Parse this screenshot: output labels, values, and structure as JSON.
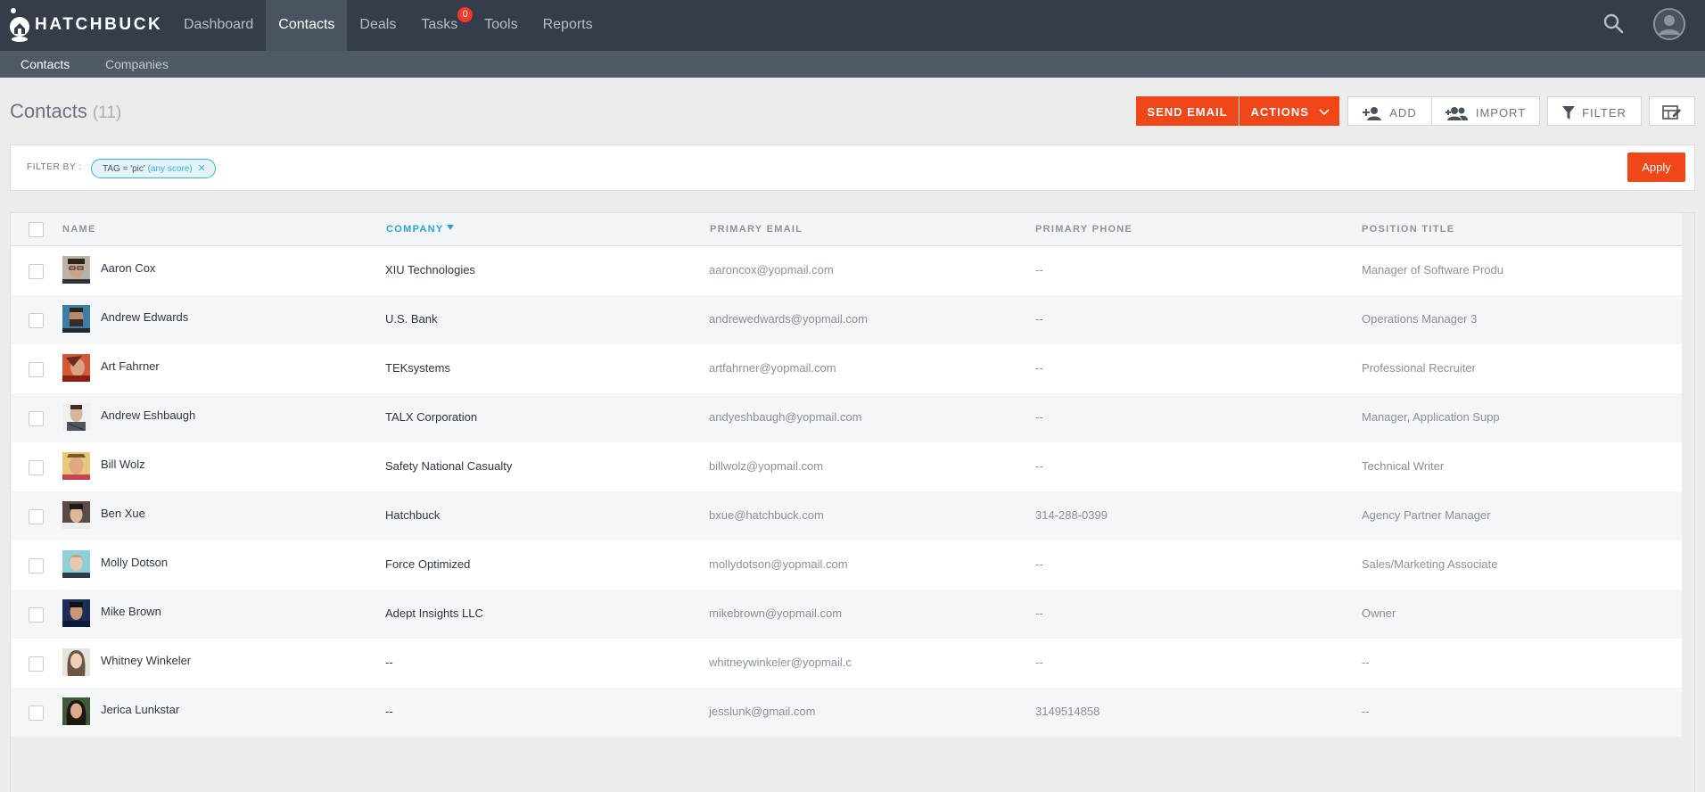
{
  "app": {
    "brand": "HATCHBUCK"
  },
  "nav": {
    "items": [
      {
        "label": "Dashboard",
        "active": false
      },
      {
        "label": "Contacts",
        "active": true
      },
      {
        "label": "Deals",
        "active": false
      },
      {
        "label": "Tasks",
        "active": false,
        "badge": "0"
      },
      {
        "label": "Tools",
        "active": false
      },
      {
        "label": "Reports",
        "active": false
      }
    ]
  },
  "subnav": {
    "items": [
      {
        "label": "Contacts",
        "active": true
      },
      {
        "label": "Companies",
        "active": false
      }
    ]
  },
  "page": {
    "title": "Contacts",
    "count": "(11)"
  },
  "toolbar": {
    "send_email": "SEND EMAIL",
    "actions": "ACTIONS",
    "add": "ADD",
    "import": "IMPORT",
    "filter": "FILTER"
  },
  "filter": {
    "label": "FILTER BY :",
    "tag_text": "TAG = 'pic'",
    "tag_score": "(any score)",
    "apply": "Apply"
  },
  "table": {
    "columns": {
      "name": "NAME",
      "company": "COMPANY",
      "email": "PRIMARY EMAIL",
      "phone": "PRIMARY PHONE",
      "title": "POSITION TITLE"
    },
    "rows": [
      {
        "name": "Aaron Cox",
        "company": "XIU Technologies",
        "email": "aaroncox@yopmail.com",
        "phone": "--",
        "title": "Manager of Software Produ"
      },
      {
        "name": "Andrew Edwards",
        "company": "U.S. Bank",
        "email": "andrewedwards@yopmail.com",
        "phone": "--",
        "title": "Operations Manager 3"
      },
      {
        "name": "Art Fahrner",
        "company": "TEKsystems",
        "email": "artfahrner@yopmail.com",
        "phone": "--",
        "title": "Professional Recruiter"
      },
      {
        "name": "Andrew Eshbaugh",
        "company": "TALX Corporation",
        "email": "andyeshbaugh@yopmail.com",
        "phone": "--",
        "title": "Manager, Application Supp"
      },
      {
        "name": "Bill Wolz",
        "company": "Safety National Casualty",
        "email": "billwolz@yopmail.com",
        "phone": "--",
        "title": "Technical Writer"
      },
      {
        "name": "Ben Xue",
        "company": "Hatchbuck",
        "email": "bxue@hatchbuck.com",
        "phone": "314-288-0399",
        "title": "Agency Partner Manager"
      },
      {
        "name": "Molly Dotson",
        "company": "Force Optimized",
        "email": "mollydotson@yopmail.com",
        "phone": "--",
        "title": "Sales/Marketing Associate"
      },
      {
        "name": "Mike Brown",
        "company": "Adept Insights LLC",
        "email": "mikebrown@yopmail.com",
        "phone": "--",
        "title": "Owner"
      },
      {
        "name": "Whitney Winkeler",
        "company": "--",
        "email": "whitneywinkeler@yopmail.c",
        "phone": "--",
        "title": "--"
      },
      {
        "name": "Jerica Lunkstar",
        "company": "--",
        "email": "jesslunk@gmail.com",
        "phone": "3149514858",
        "title": "--"
      }
    ]
  },
  "colors": {
    "accent": "#f0471a",
    "link": "#29a4d5",
    "nav_bg": "#343d49",
    "subnav_bg": "#505a67"
  },
  "icons": [
    "hatchbuck-logo-icon",
    "search-icon",
    "user-avatar-icon",
    "chevron-down-icon",
    "add-user-icon",
    "import-users-icon",
    "filter-icon",
    "column-settings-icon",
    "close-icon"
  ]
}
